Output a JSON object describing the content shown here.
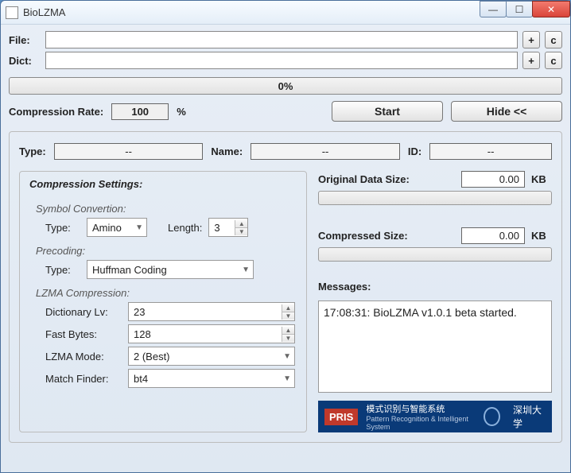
{
  "window": {
    "title": "BioLZMA"
  },
  "file_row": {
    "label": "File:",
    "value": "",
    "add": "+",
    "clear": "c"
  },
  "dict_row": {
    "label": "Dict:",
    "value": "",
    "add": "+",
    "clear": "c"
  },
  "progress": {
    "text": "0%"
  },
  "rate": {
    "label": "Compression Rate:",
    "value": "100",
    "unit": "%"
  },
  "buttons": {
    "start": "Start",
    "hide": "Hide <<"
  },
  "meta": {
    "type_label": "Type:",
    "type_value": "--",
    "name_label": "Name:",
    "name_value": "--",
    "id_label": "ID:",
    "id_value": "--"
  },
  "settings": {
    "legend": "Compression Settings:",
    "symbol": {
      "title": "Symbol Convertion:",
      "type_label": "Type:",
      "type_value": "Amino",
      "length_label": "Length:",
      "length_value": "3"
    },
    "precoding": {
      "title": "Precoding:",
      "type_label": "Type:",
      "type_value": "Huffman Coding"
    },
    "lzma": {
      "title": "LZMA Compression:",
      "dict_label": "Dictionary Lv:",
      "dict_value": "23",
      "fast_label": "Fast Bytes:",
      "fast_value": "128",
      "mode_label": "LZMA Mode:",
      "mode_value": "2 (Best)",
      "match_label": "Match Finder:",
      "match_value": "bt4"
    }
  },
  "sizes": {
    "orig_label": "Original Data Size:",
    "orig_value": "0.00",
    "orig_unit": "KB",
    "comp_label": "Compressed Size:",
    "comp_value": "0.00",
    "comp_unit": "KB"
  },
  "messages": {
    "label": "Messages:",
    "text": "17:08:31: BioLZMA v1.0.1 beta started."
  },
  "banner": {
    "pris": "PRIS",
    "cn": "模式识别与智能系统",
    "en": "Pattern Recognition & Intelligent System",
    "uni": "深圳大学"
  }
}
